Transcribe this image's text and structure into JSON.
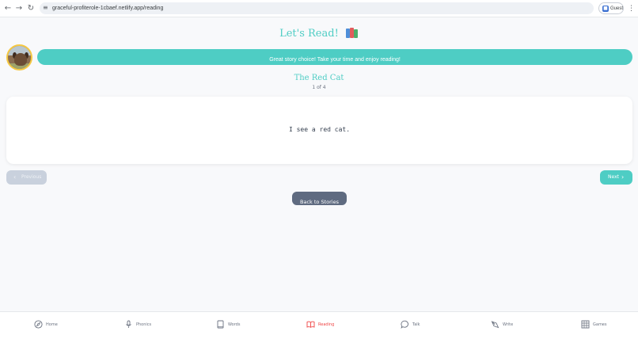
{
  "browser": {
    "url": "graceful-profiterole-1cbaef.netlify.app/reading",
    "back_icon": "←",
    "forward_icon": "→",
    "reload_icon": "↻",
    "site_info_icon": "≡",
    "profile_label": "Guest",
    "profile_icon": "person",
    "menu_icon": "⋮"
  },
  "header": {
    "title": "Let's Read!",
    "icon": "books-icon"
  },
  "banner": {
    "message": "Great story choice! Take your time and enjoy reading!"
  },
  "story": {
    "title": "The Red Cat",
    "page_indicator": "1 of 4",
    "sentence": "I see a red cat."
  },
  "controls": {
    "previous_label": "Previous",
    "previous_disabled": true,
    "next_label": "Next",
    "back_label": "Back to Stories"
  },
  "bottom_nav": {
    "items": [
      {
        "label": "Home",
        "icon": "compass-icon",
        "active": false
      },
      {
        "label": "Phonics",
        "icon": "microphone-icon",
        "active": false
      },
      {
        "label": "Words",
        "icon": "book-icon",
        "active": false
      },
      {
        "label": "Reading",
        "icon": "open-book-icon",
        "active": true
      },
      {
        "label": "Talk",
        "icon": "chat-bubble-icon",
        "active": false
      },
      {
        "label": "Write",
        "icon": "pen-icon",
        "active": false
      },
      {
        "label": "Games",
        "icon": "grid-icon",
        "active": false
      }
    ]
  },
  "colors": {
    "accent": "#4ecdc4",
    "active_nav": "#ef4444",
    "back_button": "#5f6b80",
    "disabled_button": "#c9d1dd",
    "avatar_border": "#f5c842"
  }
}
